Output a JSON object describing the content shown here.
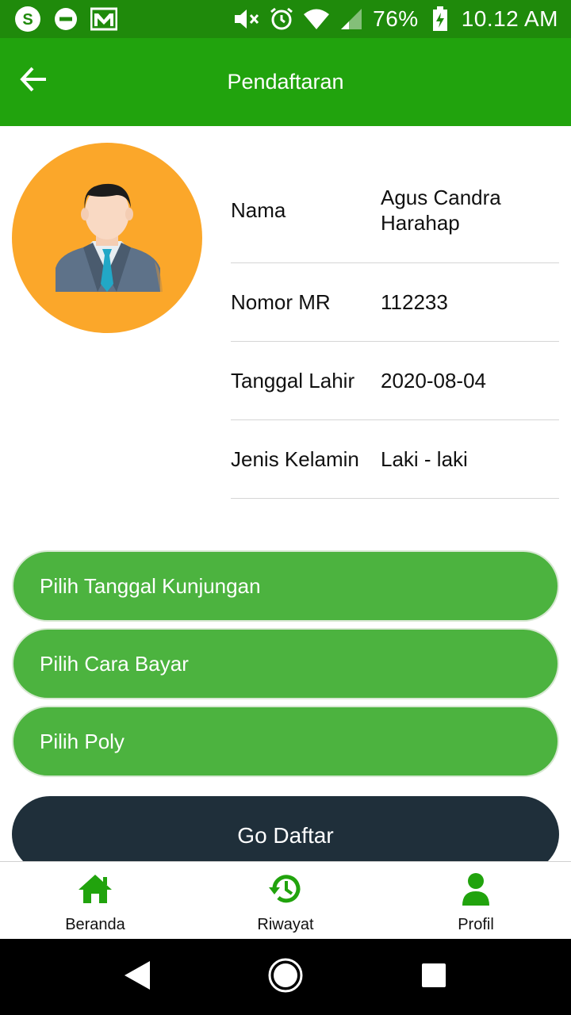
{
  "status_bar": {
    "battery": "76%",
    "time": "10.12 AM",
    "icons": [
      "skype-icon",
      "dnd-icon",
      "gmail-icon",
      "mute-icon",
      "alarm-icon",
      "wifi-icon",
      "signal-icon",
      "battery-charging-icon"
    ]
  },
  "app_bar": {
    "title": "Pendaftaran",
    "back_icon": "arrow-left-icon"
  },
  "profile": {
    "fields": [
      {
        "label": "Nama",
        "value": "Agus Candra Harahap"
      },
      {
        "label": "Nomor MR",
        "value": "112233"
      },
      {
        "label": "Tanggal Lahir",
        "value": "2020-08-04"
      },
      {
        "label": "Jenis Kelamin",
        "value": "Laki - laki"
      }
    ]
  },
  "actions": {
    "visit_date": "Pilih Tanggal Kunjungan",
    "payment": "Pilih Cara Bayar",
    "poly": "Pilih Poly",
    "submit": "Go Daftar"
  },
  "bottom_nav": {
    "items": [
      {
        "label": "Beranda",
        "icon": "home-icon"
      },
      {
        "label": "Riwayat",
        "icon": "history-icon"
      },
      {
        "label": "Profil",
        "icon": "person-icon"
      }
    ]
  },
  "colors": {
    "status_bar": "#1f8a0b",
    "app_bar": "#21a30d",
    "pill_button": "#4cb33f",
    "submit_button": "#1f2f3a",
    "avatar_bg": "#fba72a",
    "nav_icon": "#21a30d"
  }
}
